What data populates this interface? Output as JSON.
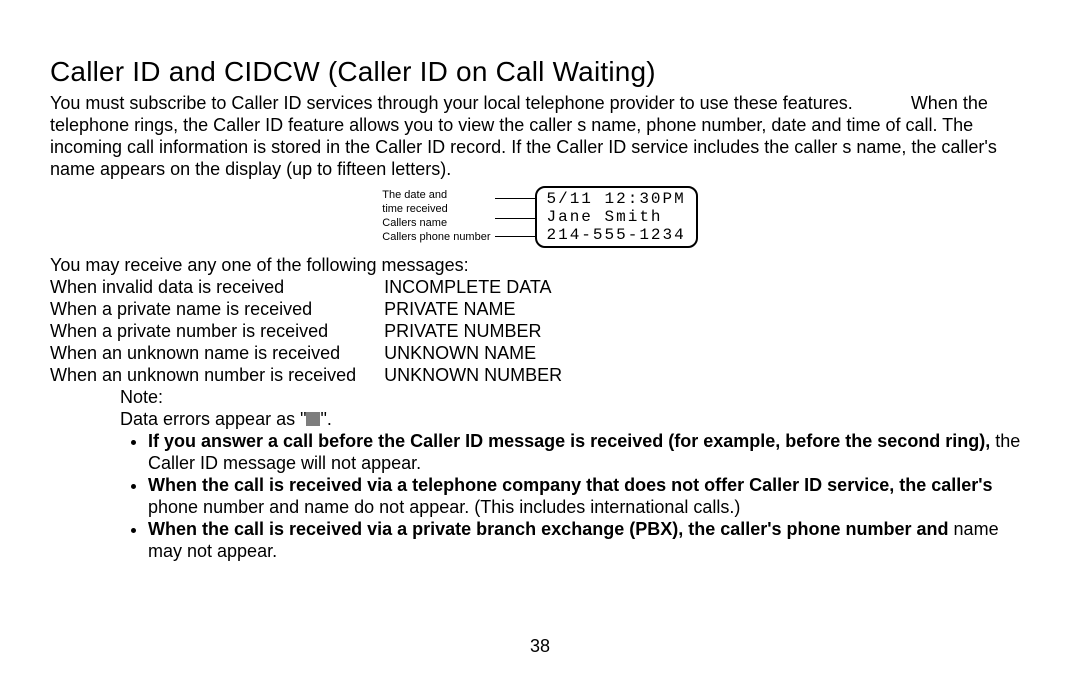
{
  "title": "Caller ID and CIDCW (Caller ID on Call Waiting)",
  "intro_part1": "You must subscribe to Caller ID services through your local telephone provider to use these features.",
  "intro_part2": "When the telephone rings, the Caller ID feature allows you to view the caller s name, phone number, date and time of call. The incoming call information is stored in the Caller ID record. If the Caller ID service includes the caller s name, the caller's name appears on the display (up to fifteen letters).",
  "diagram": {
    "label_date": "The date and",
    "label_time": "time received",
    "label_name": "Callers name",
    "label_phone": "Callers phone number",
    "screen_line1": "5/11 12:30PM",
    "screen_line2": "Jane Smith",
    "screen_line3": "214-555-1234"
  },
  "messages_header": "You may receive any one of the following messages:",
  "messages": [
    {
      "when": "When invalid data is received",
      "msg": "INCOMPLETE DATA"
    },
    {
      "when": "When a private name is received",
      "msg": "PRIVATE NAME"
    },
    {
      "when": "When a private number is received",
      "msg": "PRIVATE NUMBER"
    },
    {
      "when": "When an unknown name is received",
      "msg": "UNKNOWN NAME"
    },
    {
      "when": "When an unknown number is received",
      "msg": "UNKNOWN NUMBER"
    }
  ],
  "note_label": "Note:",
  "note_data_errors_pre": "Data errors appear as   \"",
  "note_data_errors_post": "\".",
  "bullets": [
    {
      "bold": "If you answer a call before the Caller ID message is received (for example, before the second ring),",
      "rest": " the Caller ID message will not appear."
    },
    {
      "bold": "When the call is received via a telephone company that does not offer Caller ID service, the caller's",
      "rest": " phone number and name do not appear. (This includes international calls.)"
    },
    {
      "bold": "When the call is received via a private branch exchange (PBX), the caller's phone number and",
      "rest": " name may not appear."
    }
  ],
  "page_number": "38"
}
